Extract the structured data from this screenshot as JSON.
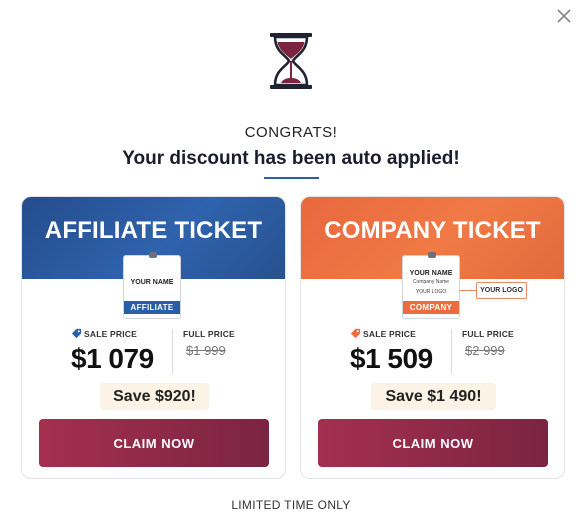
{
  "dialog": {
    "congrats": "CONGRATS!",
    "headline": "Your discount has been auto applied!",
    "footer": "LIMITED TIME ONLY"
  },
  "colors": {
    "affiliate_banner": "#2f63ad",
    "company_banner": "#f07a45",
    "claim_button": "#a52f4f",
    "save_background": "#fbf4e6",
    "hourglass": "#7a2442"
  },
  "cards": [
    {
      "title": "AFFILIATE TICKET",
      "badge": {
        "name": "YOUR NAME",
        "strip": "AFFILIATE"
      },
      "sale_label": "SALE PRICE",
      "sale_price": "$1 079",
      "full_label": "FULL PRICE",
      "full_price": "$1 999",
      "save": "Save $920!",
      "cta": "CLAIM NOW"
    },
    {
      "title": "COMPANY TICKET",
      "badge": {
        "name": "YOUR NAME",
        "company": "Company Name",
        "logo": "YOUR LOGO",
        "strip": "COMPANY"
      },
      "logo_callout": "YOUR LOGO",
      "sale_label": "SALE PRICE",
      "sale_price": "$1 509",
      "full_label": "FULL PRICE",
      "full_price": "$2 999",
      "save": "Save $1 490!",
      "cta": "CLAIM NOW"
    }
  ],
  "icons": {
    "close": "close-icon",
    "hourglass": "hourglass-icon",
    "tag": "price-tag-icon"
  }
}
